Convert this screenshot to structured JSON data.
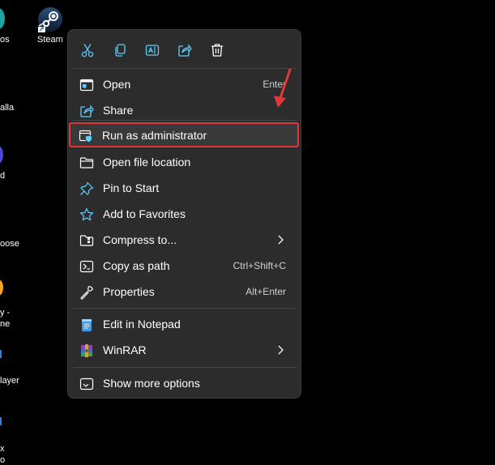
{
  "desktop": {
    "labels": [
      "os",
      "alla",
      "d",
      "oose",
      "y -",
      "ne",
      "layer",
      "x",
      "o"
    ],
    "steam_label": "Steam"
  },
  "context_menu": {
    "toolbar": [
      "cut-icon",
      "copy-icon",
      "rename-icon",
      "share-icon",
      "delete-icon"
    ],
    "items": [
      {
        "label": "Open",
        "shortcut": "Enter",
        "icon": "open-app-icon"
      },
      {
        "label": "Share",
        "icon": "share-icon"
      },
      {
        "label": "Run as administrator",
        "icon": "shield-admin-icon",
        "highlighted": true
      },
      {
        "label": "Open file location",
        "icon": "folder-icon"
      },
      {
        "label": "Pin to Start",
        "icon": "pin-icon"
      },
      {
        "label": "Add to Favorites",
        "icon": "star-icon"
      },
      {
        "label": "Compress to...",
        "icon": "zip-folder-icon",
        "submenu": true
      },
      {
        "label": "Copy as path",
        "shortcut": "Ctrl+Shift+C",
        "icon": "copy-path-icon"
      },
      {
        "label": "Properties",
        "shortcut": "Alt+Enter",
        "icon": "wrench-icon"
      },
      {
        "label": "Edit in Notepad",
        "icon": "notepad-icon"
      },
      {
        "label": "WinRAR",
        "icon": "winrar-icon",
        "submenu": true
      },
      {
        "label": "Show more options",
        "icon": "more-options-icon"
      }
    ]
  },
  "colors": {
    "menu_bg": "#2c2c2c",
    "highlight_border": "#e0383a",
    "accent_icon": "#60cdff",
    "arrow": "#e0383a"
  }
}
